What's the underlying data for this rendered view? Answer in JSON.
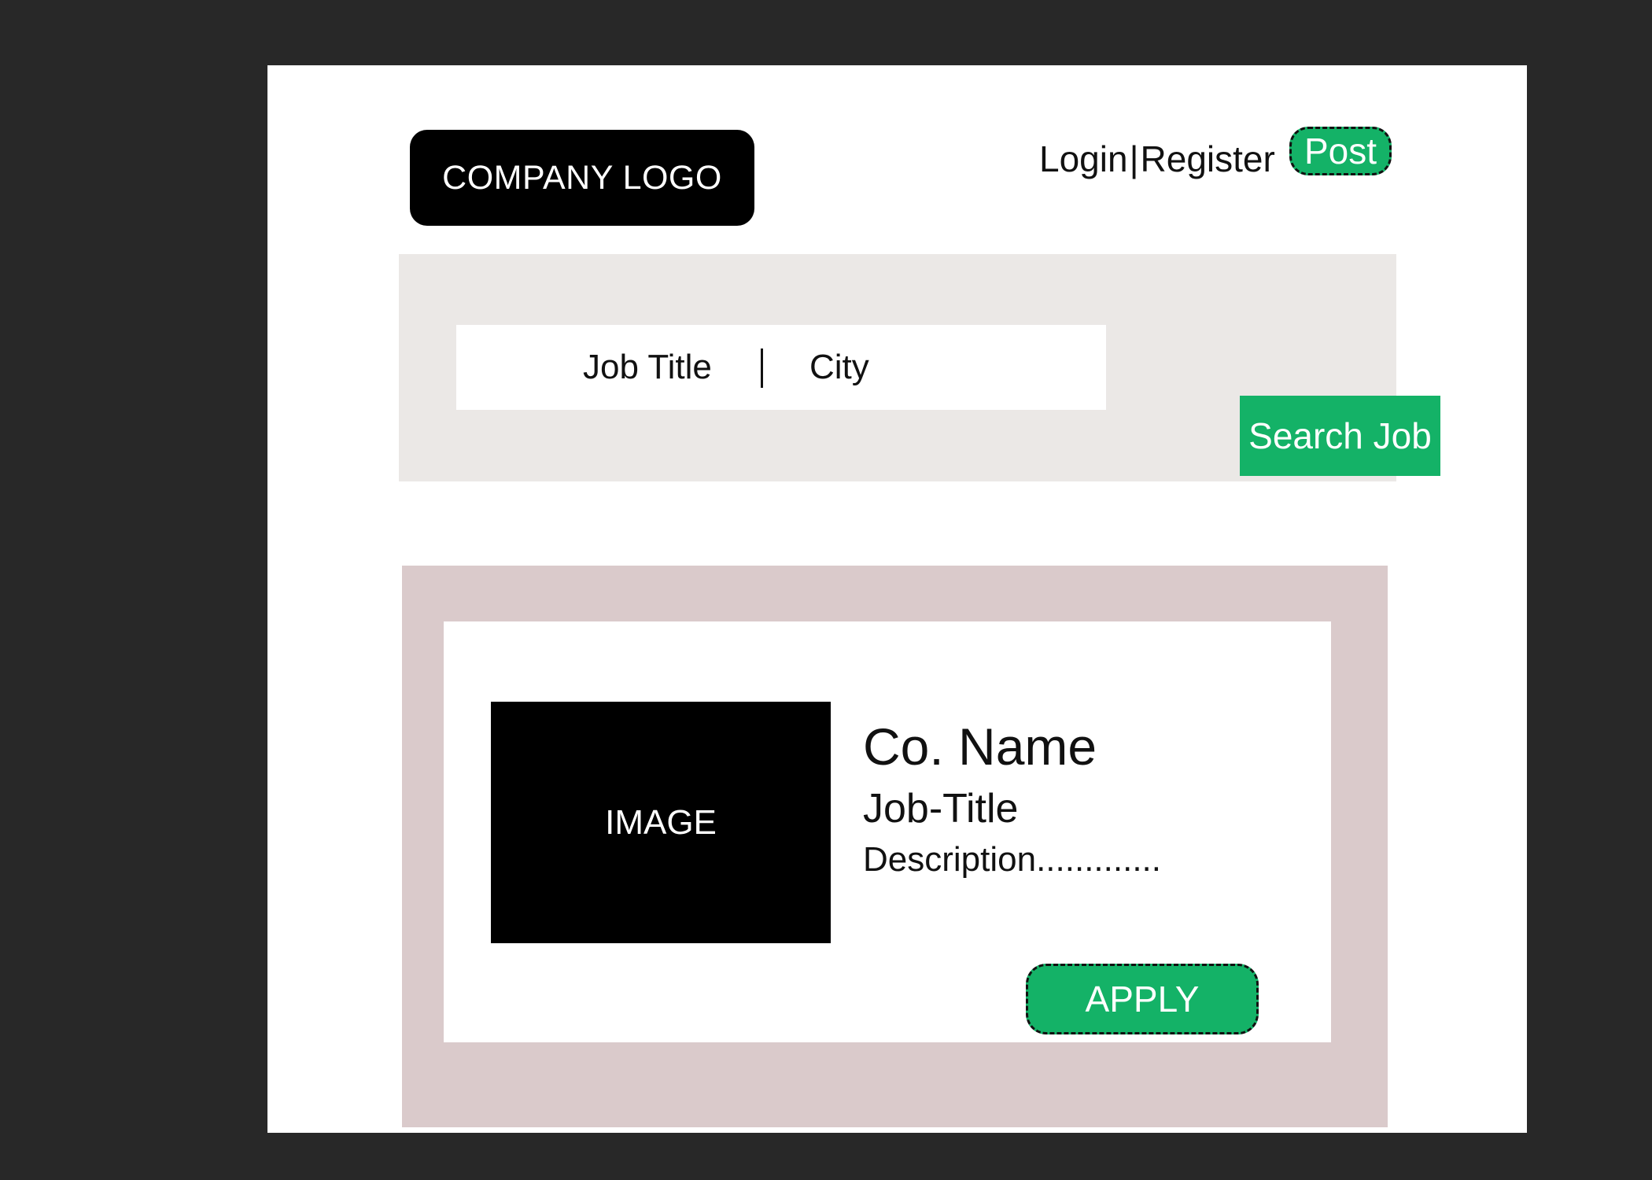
{
  "header": {
    "logo_text": "COMPANY LOGO",
    "login_label": "Login",
    "separator": "|",
    "register_label": "Register",
    "post_label": "Post"
  },
  "search": {
    "job_title_placeholder": "Job Title",
    "city_placeholder": "City",
    "button_label": "Search Job"
  },
  "listing": {
    "image_label": "IMAGE",
    "company_name": "Co. Name",
    "job_title": "Job-Title",
    "description": "Description.............",
    "apply_label": "APPLY"
  },
  "colors": {
    "accent": "#14b267",
    "background": "#282828",
    "search_panel": "#ebe8e6",
    "listing_panel": "#dacacb"
  }
}
